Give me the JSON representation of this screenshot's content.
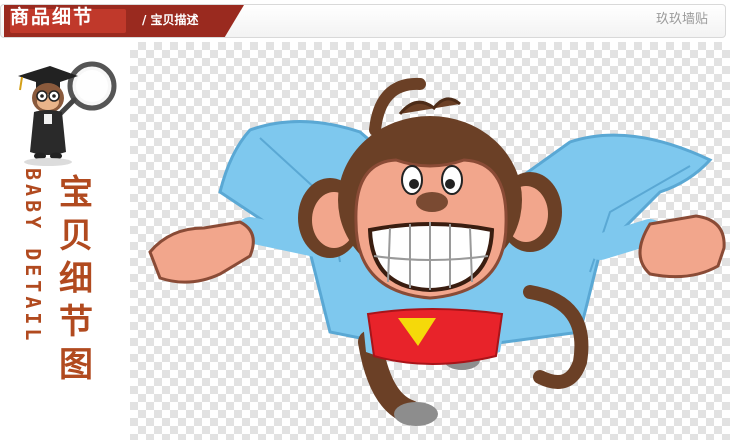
{
  "header": {
    "title": "商品细节",
    "subtitle": "/ 宝贝描述",
    "brand": "玖玖墙贴"
  },
  "side": {
    "title_cn": [
      "宝",
      "贝",
      "细",
      "节",
      "图"
    ],
    "title_en": "BABY DETAIL"
  },
  "colors": {
    "header_accent": "#c0392b",
    "header_dark": "#9a2a1f",
    "side_text": "#b14a1f"
  },
  "icons": {
    "mascot": "scholar-with-magnifier-icon",
    "product": "superhero-monkey-illustration"
  }
}
